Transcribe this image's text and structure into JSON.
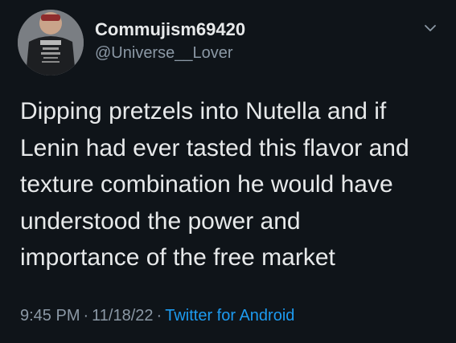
{
  "author": {
    "display_name": "Commujism69420",
    "handle": "@Universe__Lover",
    "avatar_icon": "profile-photo-patriot-shirt"
  },
  "tweet": {
    "text_lines": [
      "Dipping pretzels into Nutella and if",
      "Lenin had ever tasted this flavor and",
      "texture combination he would have",
      "understood the power and",
      "importance of the free market"
    ]
  },
  "meta": {
    "time": "9:45 PM",
    "separator": "·",
    "date": "11/18/22",
    "source": "Twitter for Android"
  },
  "icons": {
    "more": "chevron-down-icon"
  },
  "colors": {
    "background": "#0f1419",
    "text": "#e7e9ea",
    "secondary": "#8b98a5",
    "accent": "#1d9bf0"
  }
}
